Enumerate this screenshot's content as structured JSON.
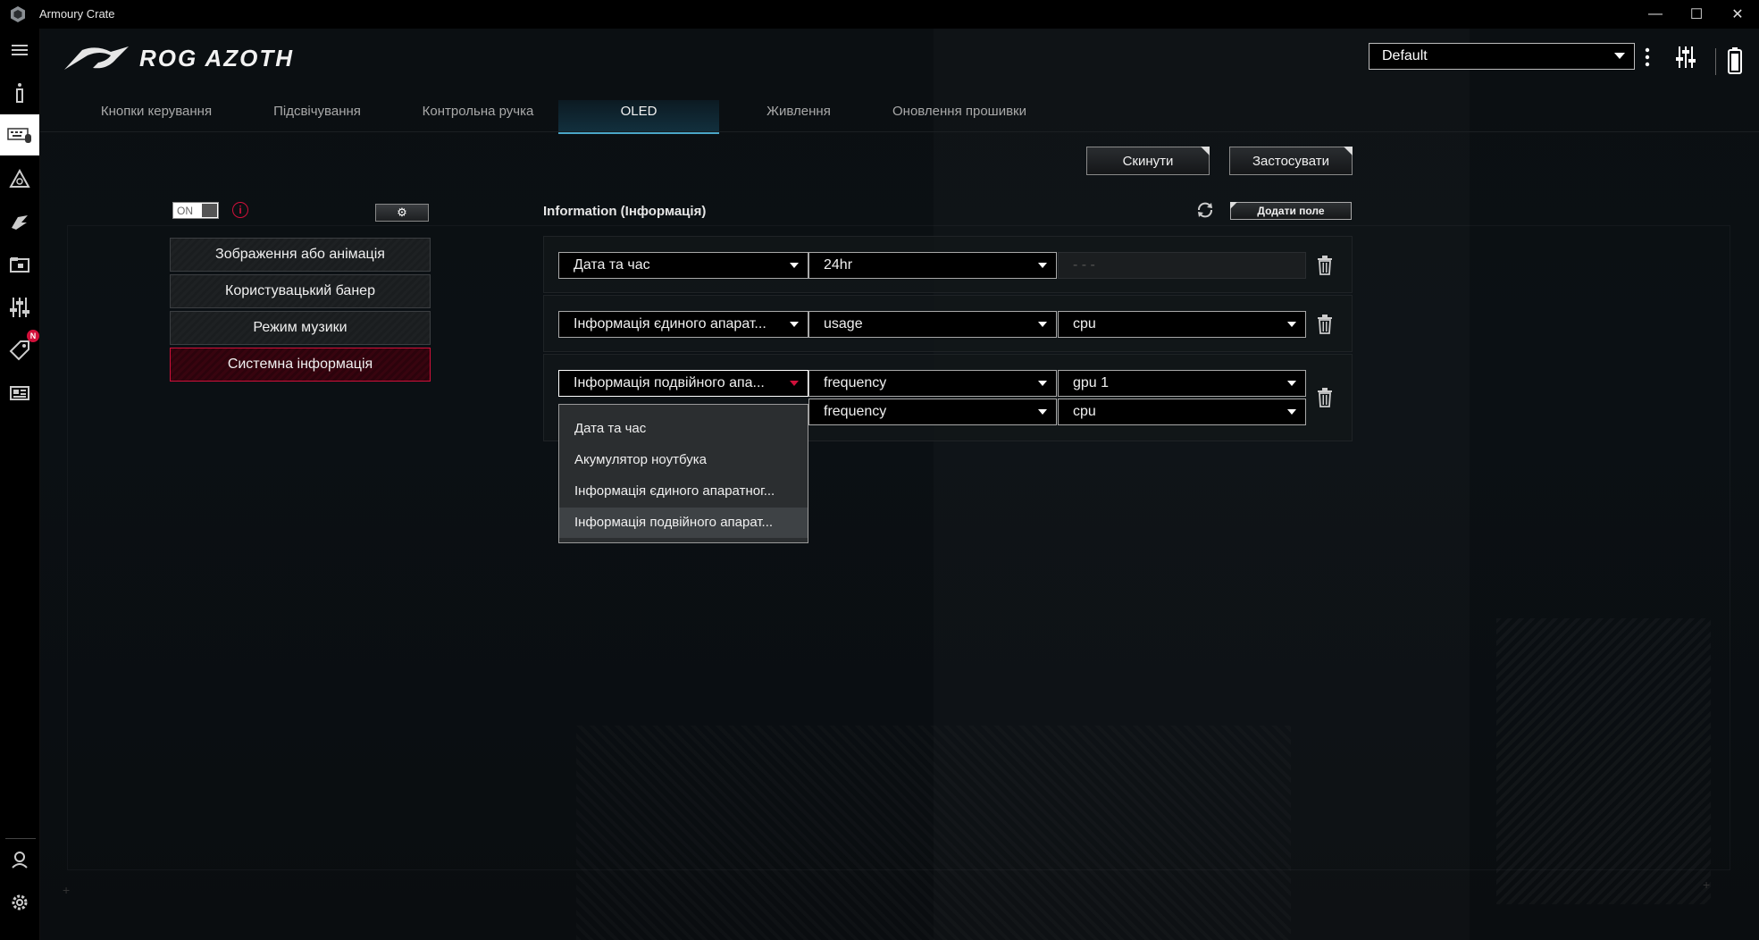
{
  "window": {
    "title": "Armoury Crate",
    "minimize": "—",
    "maximize": "☐",
    "close": "✕"
  },
  "header": {
    "product": "ROG AZOTH",
    "profile": "Default"
  },
  "tabs": [
    {
      "label": "Кнопки керування"
    },
    {
      "label": "Підсвічування"
    },
    {
      "label": "Контрольна ручка"
    },
    {
      "label": "OLED"
    },
    {
      "label": "Живлення"
    },
    {
      "label": "Оновлення прошивки"
    }
  ],
  "actions": {
    "reset": "Скинути",
    "apply": "Застосувати"
  },
  "left_panel": {
    "toggle": "ON",
    "modes": [
      {
        "label": "Зображення або анімація"
      },
      {
        "label": "Користувацький банер"
      },
      {
        "label": "Режим музики"
      },
      {
        "label": "Системна інформація"
      }
    ]
  },
  "info_panel": {
    "title": "Information (Інформація)",
    "add_field": "Додати поле",
    "rows": [
      {
        "a": "Дата та час",
        "b": "24hr",
        "c": "- - -"
      },
      {
        "a": "Інформація єдиного апарат...",
        "b": "usage",
        "c": "cpu"
      },
      {
        "a": "Інформація подвійного апа...",
        "b": "frequency",
        "c": "gpu 1",
        "b2": "frequency",
        "c2": "cpu"
      }
    ]
  },
  "dropdown": {
    "items": [
      {
        "label": "Дата та час"
      },
      {
        "label": "Акумулятор ноутбука"
      },
      {
        "label": "Інформація єдиного апаратног..."
      },
      {
        "label": "Інформація подвійного апарат..."
      }
    ]
  },
  "sidebar": {
    "badge": "N"
  },
  "colors": {
    "accent": "#d0103a",
    "tab_highlight": "#4aa6c7",
    "background": "#0b0f12"
  }
}
